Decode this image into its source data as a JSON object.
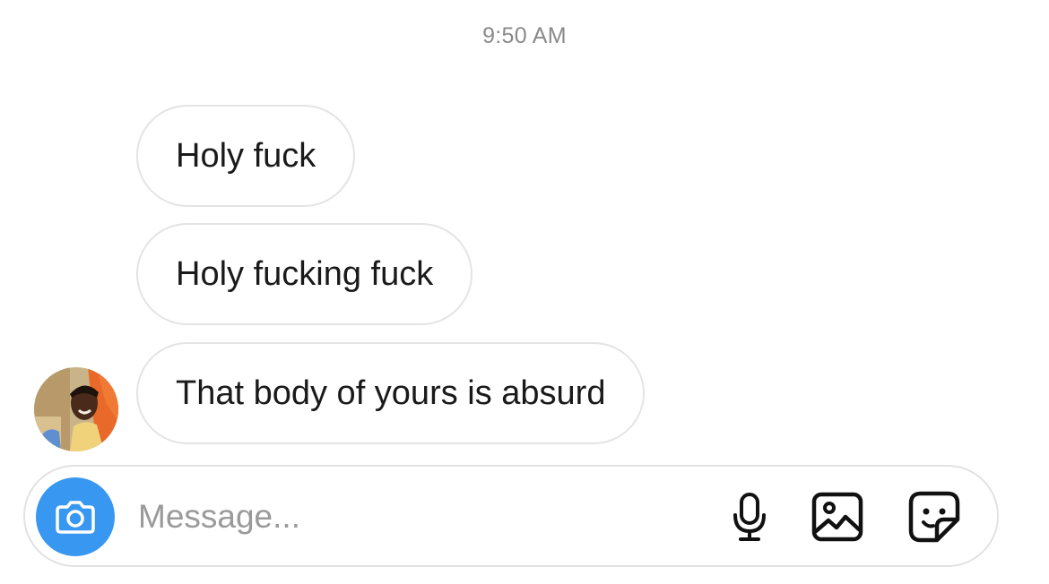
{
  "conversation": {
    "timestamp": "9:50 AM",
    "messages": [
      {
        "text": "Holy fuck"
      },
      {
        "text": "Holy fucking fuck"
      },
      {
        "text": "That body of yours is absurd"
      }
    ]
  },
  "composer": {
    "placeholder": "Message...",
    "value": "",
    "icons": [
      "camera-icon",
      "microphone-icon",
      "gallery-icon",
      "sticker-icon"
    ]
  },
  "colors": {
    "accent": "#3897f0",
    "bubble_border": "#e4e4e4",
    "timestamp": "#8a8a8a",
    "placeholder": "#9a9a9a"
  }
}
